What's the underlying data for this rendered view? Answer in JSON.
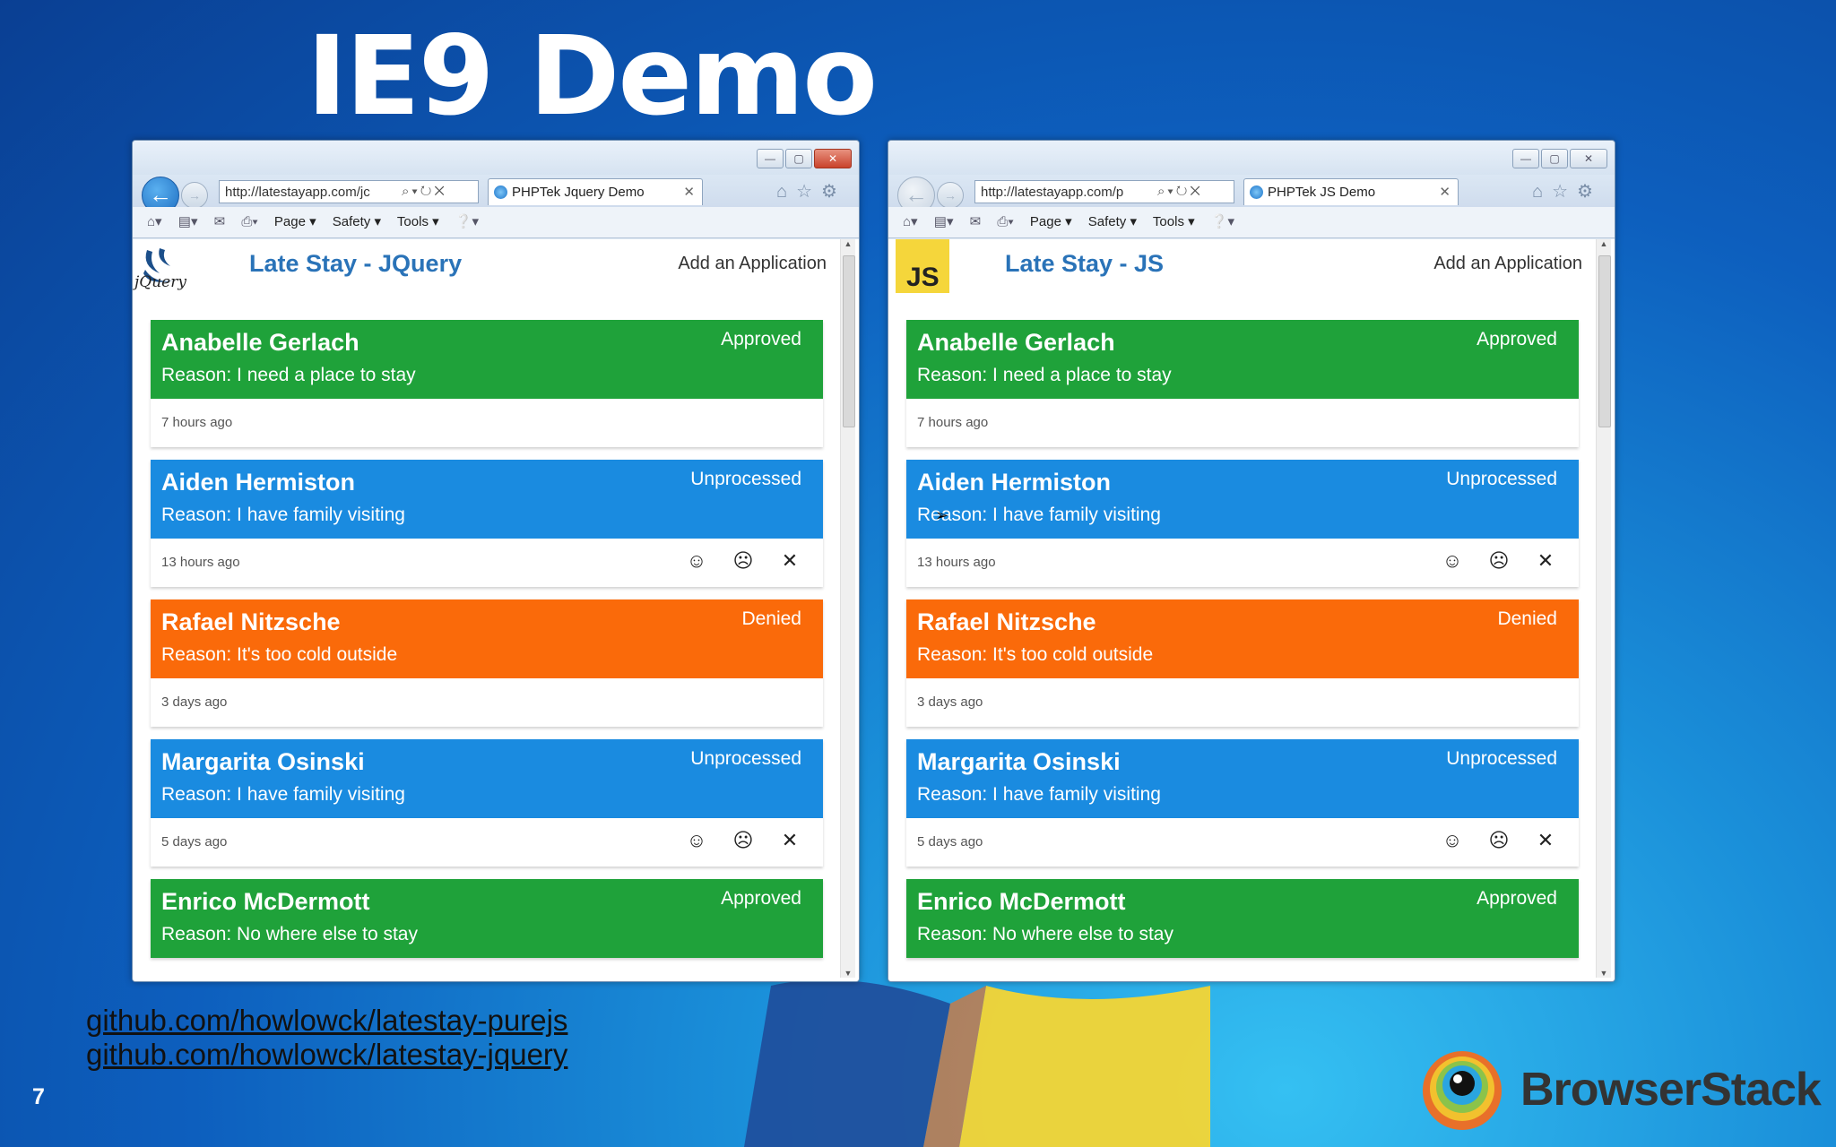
{
  "slide": {
    "title": "IE9 Demo",
    "links": [
      "github.com/howlowck/latestay-purejs",
      "github.com/howlowck/latestay-jquery"
    ],
    "page_number": "7",
    "brand": "BrowserStack"
  },
  "browsers": [
    {
      "address": "http://latestayapp.com/jc",
      "tab_title": "PHPTek Jquery Demo",
      "logo": "jQuery",
      "app_title": "Late Stay - JQuery",
      "add_link": "Add an Application"
    },
    {
      "address": "http://latestayapp.com/p",
      "tab_title": "PHPTek JS Demo",
      "logo": "JS",
      "app_title": "Late Stay - JS",
      "add_link": "Add an Application"
    }
  ],
  "commandbar": {
    "page": "Page ▾",
    "safety": "Safety ▾",
    "tools": "Tools ▾"
  },
  "applications": [
    {
      "name": "Anabelle Gerlach",
      "reason": "Reason: I need a place to stay",
      "status": "Approved",
      "time": "7 hours ago"
    },
    {
      "name": "Aiden Hermiston",
      "reason": "Reason: I have family visiting",
      "status": "Unprocessed",
      "time": "13 hours ago"
    },
    {
      "name": "Rafael Nitzsche",
      "reason": "Reason: It's too cold outside",
      "status": "Denied",
      "time": "3 days ago"
    },
    {
      "name": "Margarita Osinski",
      "reason": "Reason: I have family visiting",
      "status": "Unprocessed",
      "time": "5 days ago"
    },
    {
      "name": "Enrico McDermott",
      "reason": "Reason: No where else to stay",
      "status": "Approved",
      "time": ""
    }
  ],
  "colors": {
    "approved": "#1fa23a",
    "unprocessed": "#1a8be0",
    "denied": "#fa6a0a",
    "title_blue": "#2a73b8",
    "js_yellow": "#f5d63b"
  },
  "icons": {
    "approve": "smile-icon",
    "deny": "frown-icon",
    "delete": "close-icon"
  }
}
